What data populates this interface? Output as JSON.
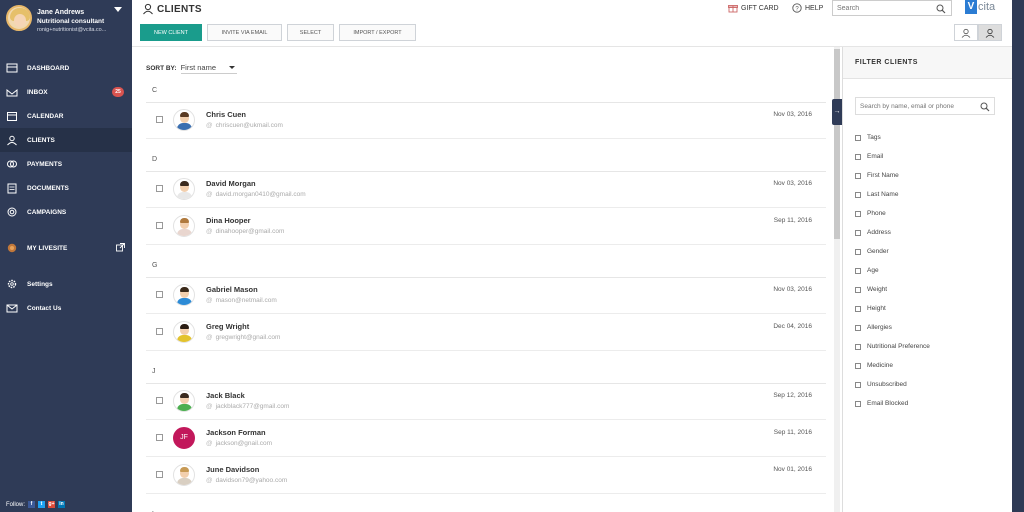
{
  "user": {
    "name": "Jane Andrews",
    "role": "Nutritional consultant",
    "email": "ronig+nutritionist@vcita.co..."
  },
  "nav": [
    {
      "label": "DASHBOARD",
      "icon": "dashboard-icon"
    },
    {
      "label": "INBOX",
      "icon": "inbox-icon",
      "badge": "25"
    },
    {
      "label": "CALENDAR",
      "icon": "calendar-icon"
    },
    {
      "label": "CLIENTS",
      "icon": "clients-icon",
      "active": true
    },
    {
      "label": "PAYMENTS",
      "icon": "payments-icon"
    },
    {
      "label": "DOCUMENTS",
      "icon": "documents-icon"
    },
    {
      "label": "CAMPAIGNS",
      "icon": "campaigns-icon"
    },
    {
      "label": "MY LIVESITE",
      "icon": "livesite-icon"
    },
    {
      "label": "Settings",
      "icon": "gear-icon"
    },
    {
      "label": "Contact Us",
      "icon": "envelope-icon"
    }
  ],
  "follow": {
    "label": "Follow:",
    "networks": [
      "f",
      "t",
      "g+",
      "in"
    ]
  },
  "header": {
    "title": "CLIENTS",
    "gift_card": "GIFT CARD",
    "help": "HELP",
    "search_placeholder": "Search",
    "logo_letter": "V",
    "logo_text": "cita"
  },
  "toolbar": {
    "new_client": "NEW CLIENT",
    "invite": "INVITE VIA EMAIL",
    "select": "SELECT",
    "import_export": "IMPORT / EXPORT"
  },
  "sort": {
    "label": "SORT BY:",
    "value": "First name"
  },
  "groups": [
    {
      "letter": "C",
      "clients": [
        {
          "name": "Chris Cuen",
          "email": "chriscuen@ukmail.com",
          "date": "Nov 03, 2016",
          "hair": "#5a3a22",
          "body": "#3b6fb0"
        }
      ]
    },
    {
      "letter": "D",
      "clients": [
        {
          "name": "David Morgan",
          "email": "david.morgan0410@gmail.com",
          "date": "Nov 03, 2016",
          "hair": "#3a2a1e",
          "body": "#e8e8e8"
        },
        {
          "name": "Dina Hooper",
          "email": "dinahooper@gmail.com",
          "date": "Sep 11, 2016",
          "hair": "#b07a3e",
          "body": "#e9d6cf"
        }
      ]
    },
    {
      "letter": "G",
      "clients": [
        {
          "name": "Gabriel Mason",
          "email": "mason@netmail.com",
          "date": "Nov 03, 2016",
          "hair": "#3b2a1a",
          "body": "#2d8bd6"
        },
        {
          "name": "Greg Wright",
          "email": "gregwright@gnail.com",
          "date": "Dec 04, 2016",
          "hair": "#2a1c12",
          "body": "#e3c32e"
        }
      ]
    },
    {
      "letter": "J",
      "clients": [
        {
          "name": "Jack Black",
          "email": "jackblack777@gmail.com",
          "date": "Sep 12, 2016",
          "hair": "#3a2a1e",
          "body": "#4caf50"
        },
        {
          "name": "Jackson Forman",
          "email": "jackson@gnail.com",
          "date": "Sep 11, 2016",
          "initials": "JF"
        },
        {
          "name": "June Davidson",
          "email": "davidson79@yahoo.com",
          "date": "Nov 01, 2016",
          "hair": "#c79a55",
          "body": "#d9cfc2"
        }
      ]
    },
    {
      "letter": "L",
      "clients": []
    }
  ],
  "filter": {
    "title": "FILTER CLIENTS",
    "search_placeholder": "Search by name, email or phone",
    "options": [
      "Tags",
      "Email",
      "First Name",
      "Last Name",
      "Phone",
      "Address",
      "Gender",
      "Age",
      "Weight",
      "Height",
      "Allergies",
      "Nutritional Preference",
      "Medicine",
      "Unsubscribed",
      "Email Blocked"
    ]
  },
  "colors": {
    "sidebar": "#2f3b57",
    "accent": "#1a9c8c",
    "badge": "#d9534f",
    "logo": "#2b7cd3"
  }
}
